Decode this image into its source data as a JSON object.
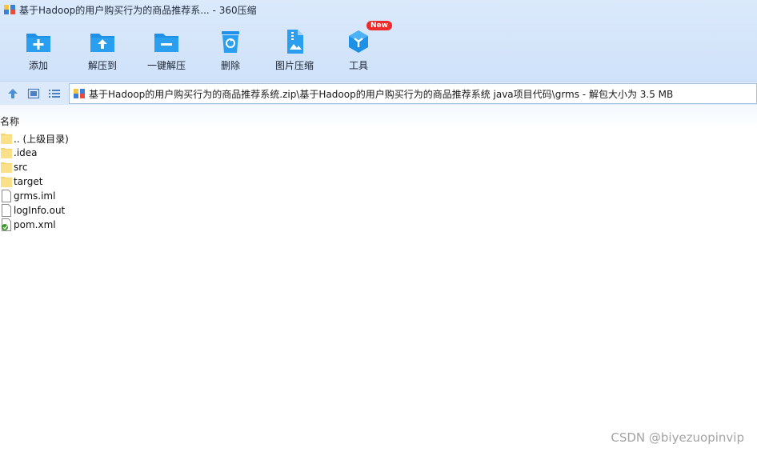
{
  "window": {
    "title": "基于Hadoop的用户购买行为的商品推荐系... - 360压缩"
  },
  "toolbar": {
    "buttons": [
      {
        "label": "添加",
        "icon": "add-folder-icon"
      },
      {
        "label": "解压到",
        "icon": "extract-to-icon"
      },
      {
        "label": "一键解压",
        "icon": "one-click-extract-icon"
      },
      {
        "label": "删除",
        "icon": "trash-icon"
      },
      {
        "label": "图片压缩",
        "icon": "image-compress-icon"
      },
      {
        "label": "工具",
        "icon": "tools-cube-icon",
        "badge": "New"
      }
    ]
  },
  "address": {
    "path": "基于Hadoop的用户购买行为的商品推荐系统.zip\\基于Hadoop的用户购买行为的商品推荐系统  java项目代码\\grms - 解包大小为 3.5 MB"
  },
  "list": {
    "column_name": "名称",
    "items": [
      {
        "name": ".. (上级目录)",
        "type": "folder"
      },
      {
        "name": ".idea",
        "type": "folder"
      },
      {
        "name": "src",
        "type": "folder"
      },
      {
        "name": "target",
        "type": "folder"
      },
      {
        "name": "grms.iml",
        "type": "file"
      },
      {
        "name": "logInfo.out",
        "type": "file"
      },
      {
        "name": "pom.xml",
        "type": "xml"
      }
    ]
  },
  "watermark": "CSDN @biyezuopinvip",
  "colors": {
    "toolbar_bg": "#d6e6fa",
    "icon_blue": "#1e90e6",
    "badge_red": "#ef2a2a",
    "folder_yellow": "#f7d468"
  }
}
